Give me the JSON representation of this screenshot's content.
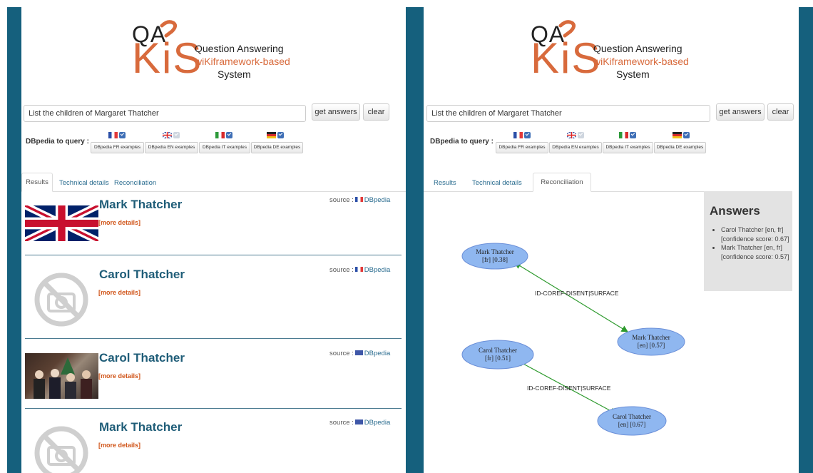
{
  "logo": {
    "qa": "QA",
    "kis": "KiS",
    "line1": "Question Answering",
    "line2": "wiKiframework-based",
    "line3": "System"
  },
  "search": {
    "query": "List the children of Margaret Thatcher",
    "get_answers_label": "get answers",
    "clear_label": "clear"
  },
  "dbpedia": {
    "label": "DBpedia to query :",
    "examples": [
      {
        "lang": "FR",
        "label": "DBpedia FR examples",
        "checked": true
      },
      {
        "lang": "EN",
        "label": "DBpedia EN examples",
        "checked": false
      },
      {
        "lang": "IT",
        "label": "DBpedia IT examples",
        "checked": true
      },
      {
        "lang": "DE",
        "label": "DBpedia DE examples",
        "checked": true
      }
    ]
  },
  "tabs": {
    "results": "Results",
    "technical": "Technical details",
    "reconciliation": "Reconciliation"
  },
  "results": [
    {
      "title": "Mark Thatcher",
      "more": "[more details]",
      "source_label": "source :",
      "source_lang": "FR",
      "source_name": "DBpedia",
      "image": "union-jack-flag"
    },
    {
      "title": "Carol Thatcher",
      "more": "[more details]",
      "source_label": "source :",
      "source_lang": "FR",
      "source_name": "DBpedia",
      "image": "no-photo-placeholder"
    },
    {
      "title": "Carol Thatcher",
      "more": "[more details]",
      "source_label": "source :",
      "source_lang": "EN",
      "source_name": "DBpedia",
      "image": "group-photo"
    },
    {
      "title": "Mark Thatcher",
      "more": "[more details]",
      "source_label": "source :",
      "source_lang": "EN",
      "source_name": "DBpedia",
      "image": "no-photo-placeholder"
    }
  ],
  "answers": {
    "heading": "Answers",
    "items": [
      "Carol Thatcher [en, fr] [confidence score: 0.67]",
      "Mark Thatcher [en, fr] [confidence score: 0.57]"
    ]
  },
  "graph": {
    "nodes": [
      {
        "line1": "Mark Thatcher",
        "line2": "[fr] [0.38]"
      },
      {
        "line1": "Mark Thatcher",
        "line2": "[en] [0.57]"
      },
      {
        "line1": "Carol Thatcher",
        "line2": "[fr] [0.51]"
      },
      {
        "line1": "Carol Thatcher",
        "line2": "[en] [0.67]"
      }
    ],
    "edges": [
      {
        "label": "ID-COREF-DISENT|SURFACE"
      },
      {
        "label": "ID-COREF-DISENT|SURFACE"
      }
    ]
  },
  "colors": {
    "frame": "#15607d",
    "accent": "#d86a3c",
    "link": "#2a6c8f",
    "more": "#d05418",
    "node_fill": "#8fb7f0",
    "node_stroke": "#6b8fd8",
    "edge": "#2e9a2e"
  }
}
